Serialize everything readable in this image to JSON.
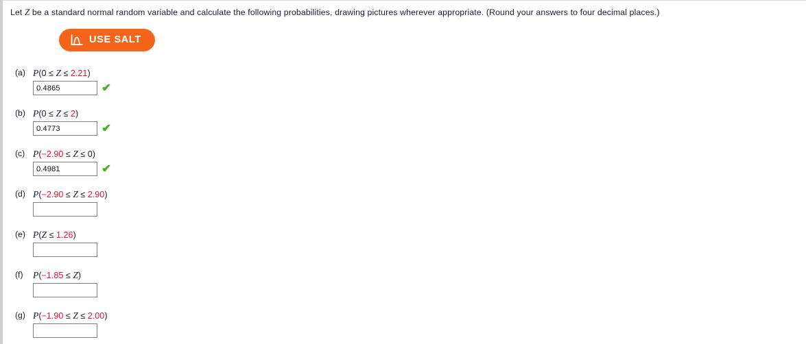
{
  "page": {
    "prompt_pre": "Let ",
    "prompt_var": "Z",
    "prompt_post": " be a standard normal random variable and calculate the following probabilities, drawing pictures wherever appropriate. (Round your answers to four decimal places.)"
  },
  "salt": {
    "label": "USE SALT",
    "icon": "normal-curve-icon",
    "color": "#f4651c"
  },
  "colors": {
    "value_red": "#e8112d",
    "check_green": "#4caf28",
    "text": "#1b1b2f",
    "input_border": "#7d7d7d"
  },
  "questions": [
    {
      "label": "(a)",
      "expr_parts": [
        {
          "text": "P",
          "style": "italic"
        },
        {
          "text": "(0 ",
          "style": "plain"
        },
        {
          "text": "≤",
          "style": "plain"
        },
        {
          "text": " ",
          "style": "plain"
        },
        {
          "text": "Z",
          "style": "italic"
        },
        {
          "text": " ",
          "style": "plain"
        },
        {
          "text": "≤",
          "style": "plain"
        },
        {
          "text": " ",
          "style": "plain"
        },
        {
          "text": "2.21",
          "style": "value"
        },
        {
          "text": ")",
          "style": "plain"
        }
      ],
      "expr_text": "P(0 ≤ Z ≤ 2.21)",
      "answer": "0.4865",
      "placeholder": "",
      "correct": true,
      "status_icon": "green-check-icon"
    },
    {
      "label": "(b)",
      "expr_parts": [
        {
          "text": "P",
          "style": "italic"
        },
        {
          "text": "(0 ",
          "style": "plain"
        },
        {
          "text": "≤",
          "style": "plain"
        },
        {
          "text": " ",
          "style": "plain"
        },
        {
          "text": "Z",
          "style": "italic"
        },
        {
          "text": " ",
          "style": "plain"
        },
        {
          "text": "≤",
          "style": "plain"
        },
        {
          "text": " ",
          "style": "plain"
        },
        {
          "text": "2",
          "style": "value"
        },
        {
          "text": ")",
          "style": "plain"
        }
      ],
      "expr_text": "P(0 ≤ Z ≤ 2)",
      "answer": "0.4773",
      "placeholder": "",
      "correct": true,
      "status_icon": "green-check-icon"
    },
    {
      "label": "(c)",
      "expr_parts": [
        {
          "text": "P",
          "style": "italic"
        },
        {
          "text": "(",
          "style": "plain"
        },
        {
          "text": "−2.90",
          "style": "value"
        },
        {
          "text": " ",
          "style": "plain"
        },
        {
          "text": "≤",
          "style": "plain"
        },
        {
          "text": " ",
          "style": "plain"
        },
        {
          "text": "Z",
          "style": "italic"
        },
        {
          "text": " ",
          "style": "plain"
        },
        {
          "text": "≤",
          "style": "plain"
        },
        {
          "text": " 0)",
          "style": "plain"
        }
      ],
      "expr_text": "P(−2.90 ≤ Z ≤ 0)",
      "answer": "0.4981",
      "placeholder": "",
      "correct": true,
      "status_icon": "green-check-icon"
    },
    {
      "label": "(d)",
      "expr_parts": [
        {
          "text": "P",
          "style": "italic"
        },
        {
          "text": "(",
          "style": "plain"
        },
        {
          "text": "−2.90",
          "style": "value"
        },
        {
          "text": " ",
          "style": "plain"
        },
        {
          "text": "≤",
          "style": "plain"
        },
        {
          "text": " ",
          "style": "plain"
        },
        {
          "text": "Z",
          "style": "italic"
        },
        {
          "text": " ",
          "style": "plain"
        },
        {
          "text": "≤",
          "style": "plain"
        },
        {
          "text": " ",
          "style": "plain"
        },
        {
          "text": "2.90",
          "style": "value"
        },
        {
          "text": ")",
          "style": "plain"
        }
      ],
      "expr_text": "P(−2.90 ≤ Z ≤ 2.90)",
      "answer": "",
      "placeholder": "",
      "correct": false,
      "status_icon": ""
    },
    {
      "label": "(e)",
      "expr_parts": [
        {
          "text": "P",
          "style": "italic"
        },
        {
          "text": "(",
          "style": "plain"
        },
        {
          "text": "Z",
          "style": "italic"
        },
        {
          "text": " ",
          "style": "plain"
        },
        {
          "text": "≤",
          "style": "plain"
        },
        {
          "text": " ",
          "style": "plain"
        },
        {
          "text": "1.26",
          "style": "value"
        },
        {
          "text": ")",
          "style": "plain"
        }
      ],
      "expr_text": "P(Z ≤ 1.26)",
      "answer": "",
      "placeholder": "",
      "correct": false,
      "status_icon": ""
    },
    {
      "label": "(f)",
      "expr_parts": [
        {
          "text": "P",
          "style": "italic"
        },
        {
          "text": "(",
          "style": "plain"
        },
        {
          "text": "−1.85",
          "style": "value"
        },
        {
          "text": " ",
          "style": "plain"
        },
        {
          "text": "≤",
          "style": "plain"
        },
        {
          "text": " ",
          "style": "plain"
        },
        {
          "text": "Z",
          "style": "italic"
        },
        {
          "text": ")",
          "style": "plain"
        }
      ],
      "expr_text": "P(−1.85 ≤ Z)",
      "answer": "",
      "placeholder": "",
      "correct": false,
      "status_icon": ""
    },
    {
      "label": "(g)",
      "expr_parts": [
        {
          "text": "P",
          "style": "italic"
        },
        {
          "text": "(",
          "style": "plain"
        },
        {
          "text": "−1.90",
          "style": "value"
        },
        {
          "text": " ",
          "style": "plain"
        },
        {
          "text": "≤",
          "style": "plain"
        },
        {
          "text": " ",
          "style": "plain"
        },
        {
          "text": "Z",
          "style": "italic"
        },
        {
          "text": " ",
          "style": "plain"
        },
        {
          "text": "≤",
          "style": "plain"
        },
        {
          "text": " ",
          "style": "plain"
        },
        {
          "text": "2.00",
          "style": "value"
        },
        {
          "text": ")",
          "style": "plain"
        }
      ],
      "expr_text": "P(−1.90 ≤ Z ≤ 2.00)",
      "answer": "",
      "placeholder": "",
      "correct": false,
      "status_icon": ""
    }
  ],
  "layout": {
    "question_tops": [
      98,
      157,
      216,
      275,
      334,
      393,
      452
    ],
    "input_tops": [
      117,
      176,
      235,
      294,
      353,
      412,
      471
    ]
  }
}
